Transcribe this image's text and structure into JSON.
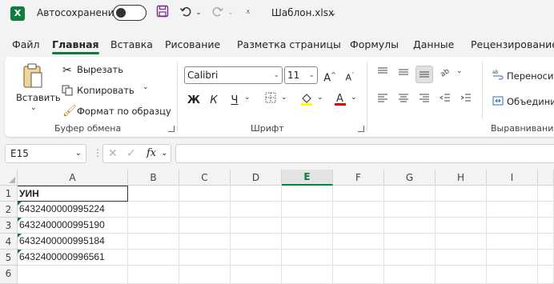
{
  "titlebar": {
    "autosave_label": "Автосохранение",
    "filename": "Шаблон.xlsx"
  },
  "tabs": [
    "Файл",
    "Главная",
    "Вставка",
    "Рисование",
    "Разметка страницы",
    "Формулы",
    "Данные",
    "Рецензирование"
  ],
  "active_tab": "Главная",
  "ribbon": {
    "clipboard": {
      "paste_label": "Вставить",
      "cut_label": "Вырезать",
      "copy_label": "Копировать",
      "format_painter_label": "Формат по образцу",
      "group_label": "Буфер обмена"
    },
    "font": {
      "font_name": "Calibri",
      "font_size": "11",
      "bold": "Ж",
      "italic": "К",
      "underline": "Ч",
      "group_label": "Шрифт"
    },
    "alignment": {
      "wrap_label": "Переносить",
      "merge_label": "Объединить",
      "group_label": "Выравнивание"
    }
  },
  "formula_bar": {
    "name_box": "E15",
    "fx": "fx",
    "value": ""
  },
  "grid": {
    "columns": [
      "A",
      "B",
      "C",
      "D",
      "E",
      "F",
      "G",
      "H",
      "I"
    ],
    "selected_column": "E",
    "rows": [
      "1",
      "2",
      "3",
      "4",
      "5",
      "6"
    ],
    "cells": {
      "A1": "УИН",
      "A2": "6432400000995224",
      "A3": "6432400000995190",
      "A4": "6432400000995184",
      "A5": "6432400000996561"
    }
  },
  "colors": {
    "accent": "#107c41",
    "font_color_red": "#e00000",
    "fill_yellow": "#ffff00"
  }
}
